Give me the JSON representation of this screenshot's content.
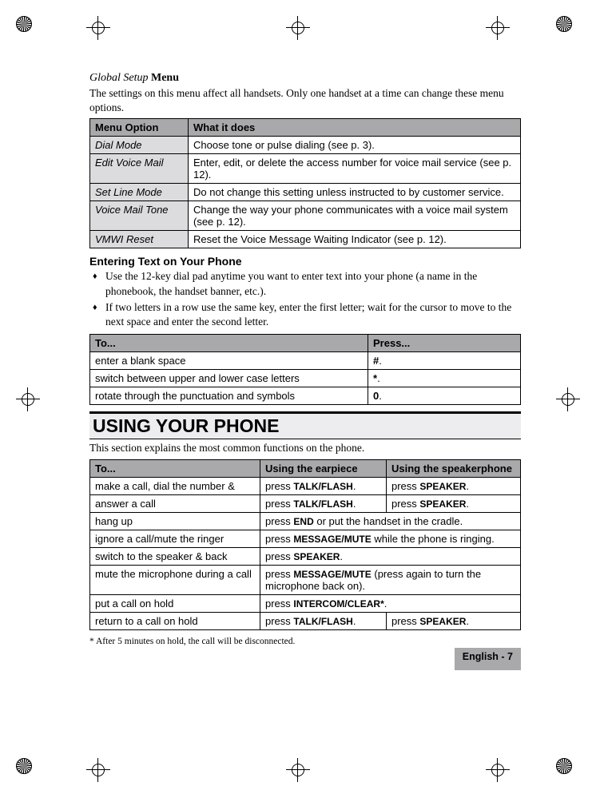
{
  "globalSetup": {
    "titlePrefix": "Global Setup ",
    "titleBold": "Menu",
    "intro": "The settings on this menu affect all handsets. Only one handset at a time can change these menu options.",
    "header1": "Menu Option",
    "header2": "What it does",
    "rows": [
      {
        "opt": "Dial Mode",
        "desc": "Choose tone or pulse dialing (see p. 3)."
      },
      {
        "opt": "Edit Voice Mail",
        "desc": "Enter, edit, or delete the access number for voice mail service (see p. 12)."
      },
      {
        "opt": "Set Line Mode",
        "desc": "Do not change this setting unless instructed to by customer service."
      },
      {
        "opt": "Voice Mail Tone",
        "desc": "Change the way your phone communicates with a voice mail system (see p. 12)."
      },
      {
        "opt": "VMWI Reset",
        "desc": "Reset the Voice Message Waiting Indicator (see p. 12)."
      }
    ]
  },
  "textEntry": {
    "heading": "Entering Text on Your Phone",
    "bullets": [
      "Use the 12-key dial pad anytime you want to enter text into your phone (a name in the phonebook, the handset banner, etc.).",
      "If two letters in a row use the same key, enter the first letter; wait for the cursor to move to the next space and enter the second letter."
    ],
    "header1": "To...",
    "header2": "Press...",
    "rows": [
      {
        "to": "enter a blank space",
        "press": "#",
        "suffix": "."
      },
      {
        "to": "switch between upper and lower case letters",
        "press": "*",
        "suffix": "."
      },
      {
        "to": "rotate through the punctuation and symbols",
        "press": "0",
        "suffix": "."
      }
    ]
  },
  "usingPhone": {
    "heading": "USING YOUR PHONE",
    "intro": "This section explains the most common functions on the phone.",
    "header1": "To...",
    "header2": "Using the earpiece",
    "header3": "Using the speakerphone",
    "rows": {
      "r1": {
        "to": "make a call, dial the number &",
        "ear_pre": "press ",
        "ear_key": "TALK/FLASH",
        "ear_suf": ".",
        "spk_pre": "press ",
        "spk_key": "SPEAKER",
        "spk_suf": "."
      },
      "r2": {
        "to": "answer a call",
        "ear_pre": "press ",
        "ear_key": "TALK/FLASH",
        "ear_suf": ".",
        "spk_pre": "press ",
        "spk_key": "SPEAKER",
        "spk_suf": "."
      },
      "r3": {
        "to": "hang up",
        "pre": "press ",
        "key": "END",
        "suf": " or put the handset in the cradle."
      },
      "r4": {
        "to": "ignore a call/mute the ringer",
        "pre": "press ",
        "key": "MESSAGE/MUTE",
        "suf": " while the phone is ringing."
      },
      "r5": {
        "to": "switch to the speaker & back",
        "pre": "press ",
        "key": "SPEAKER",
        "suf": "."
      },
      "r6": {
        "to": "mute the microphone during a call",
        "pre": "press ",
        "key": "MESSAGE/MUTE",
        "suf": " (press again to turn the microphone back on)."
      },
      "r7": {
        "to": "put a call on hold",
        "pre": "press ",
        "key": "INTERCOM/CLEAR*",
        "suf": "."
      },
      "r8": {
        "to": "return to a call on hold",
        "ear_pre": "press ",
        "ear_key": "TALK/FLASH",
        "ear_suf": ".",
        "spk_pre": "press ",
        "spk_key": "SPEAKER",
        "spk_suf": "."
      }
    },
    "footnote": "*   After 5 minutes on hold, the call will be disconnected."
  },
  "footer": "English - 7"
}
